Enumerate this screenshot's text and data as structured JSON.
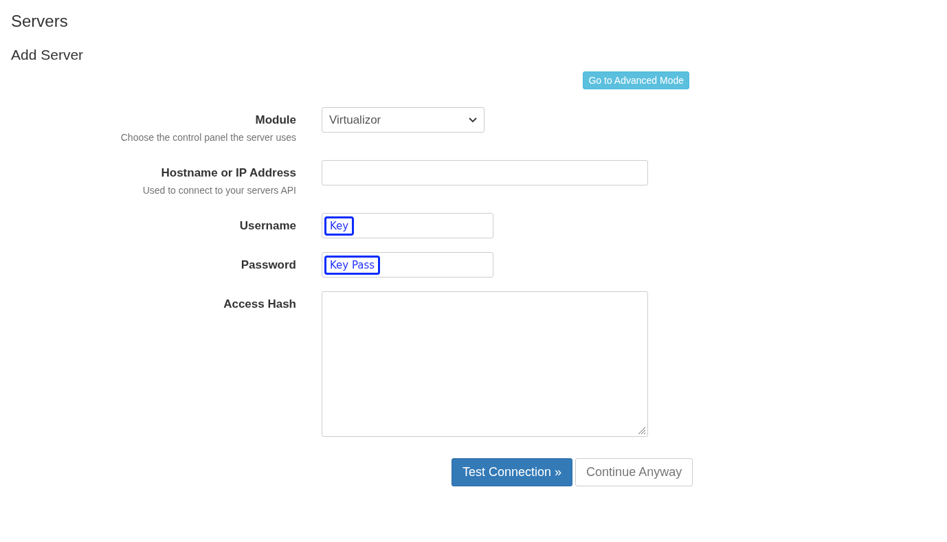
{
  "page_title": "Servers",
  "section_title": "Add Server",
  "mode_button": "Go to Advanced Mode",
  "fields": [
    {
      "kind": "select",
      "label": "Module",
      "help": "Choose the control panel the server uses",
      "value": "Virtualizor"
    },
    {
      "kind": "text",
      "label": "Hostname or IP Address",
      "help": "Used to connect to your servers API"
    },
    {
      "kind": "short_text",
      "label": "Username",
      "tag": "Key"
    },
    {
      "kind": "short_text",
      "label": "Password",
      "tag": "Key Pass"
    },
    {
      "kind": "textarea",
      "label": "Access Hash"
    }
  ],
  "buttons": [
    {
      "label": "Test Connection »",
      "kind": "primary"
    },
    {
      "label": "Continue Anyway",
      "kind": "default"
    }
  ]
}
